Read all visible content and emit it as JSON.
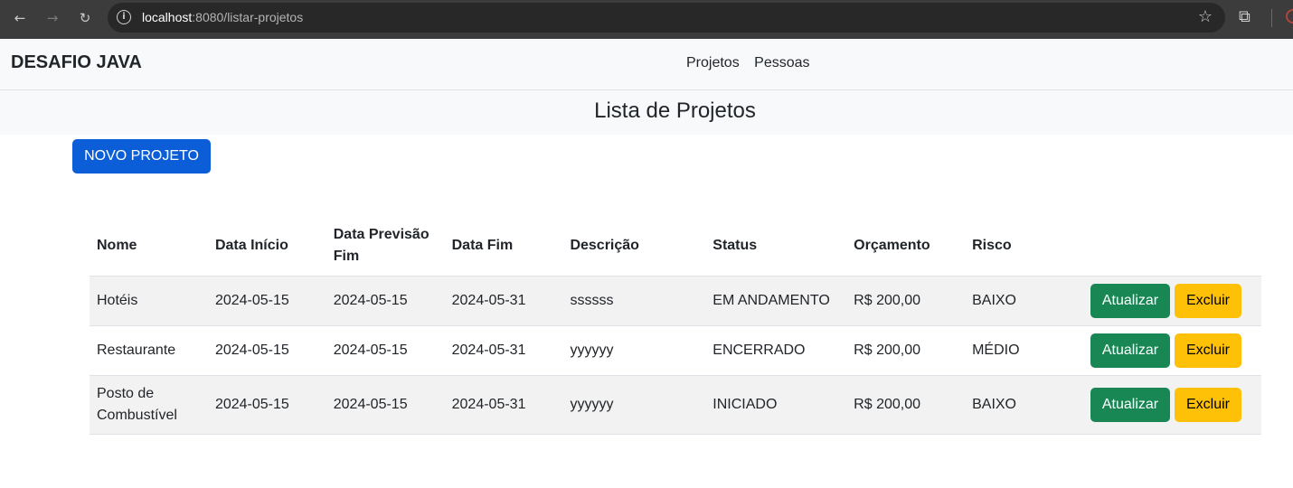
{
  "browser": {
    "back_icon": "arrow-left-icon",
    "forward_icon": "arrow-right-icon",
    "reload_icon": "reload-icon",
    "url_host": "localhost",
    "url_rest": ":8080/listar-projetos",
    "bookmark_icon": "star-icon",
    "extensions_icon": "puzzle-icon"
  },
  "navbar": {
    "brand": "DESAFIO JAVA",
    "links": [
      "Projetos",
      "Pessoas"
    ]
  },
  "page": {
    "title": "Lista de Projetos",
    "new_button": "NOVO PROJETO"
  },
  "table": {
    "headers": [
      "Nome",
      "Data Início",
      "Data Previsão Fim",
      "Data Fim",
      "Descrição",
      "Status",
      "Orçamento",
      "Risco"
    ],
    "rows": [
      {
        "nome": "Hotéis",
        "data_inicio": "2024-05-15",
        "data_previsao_fim": "2024-05-15",
        "data_fim": "2024-05-31",
        "descricao": "ssssss",
        "status": "EM ANDAMENTO",
        "orcamento": "R$ 200,00",
        "risco": "BAIXO"
      },
      {
        "nome": "Restaurante",
        "data_inicio": "2024-05-15",
        "data_previsao_fim": "2024-05-15",
        "data_fim": "2024-05-31",
        "descricao": "yyyyyy",
        "status": "ENCERRADO",
        "orcamento": "R$ 200,00",
        "risco": "MÉDIO"
      },
      {
        "nome": "Posto de Combustível",
        "data_inicio": "2024-05-15",
        "data_previsao_fim": "2024-05-15",
        "data_fim": "2024-05-31",
        "descricao": "yyyyyy",
        "status": "INICIADO",
        "orcamento": "R$ 200,00",
        "risco": "BAIXO"
      }
    ],
    "update_label": "Atualizar",
    "delete_label": "Excluir"
  },
  "colors": {
    "primary": "#0b5ed7",
    "success": "#198754",
    "warning": "#ffc107"
  }
}
